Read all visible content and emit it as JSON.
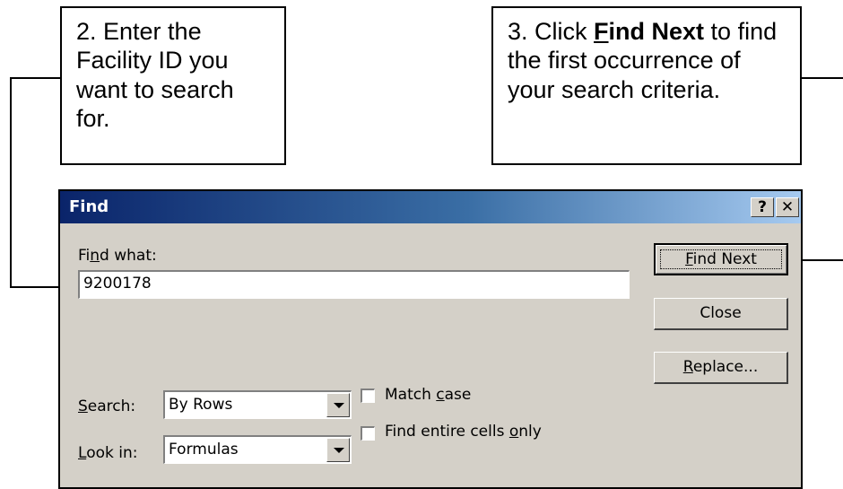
{
  "callout_2": {
    "text": "2. Enter the Facility ID you want to search for."
  },
  "callout_3": {
    "prefix": "3. Click ",
    "button_ref_first": "F",
    "button_ref_rest": "ind Next",
    "suffix": " to find the first occurrence of your search criteria."
  },
  "dialog": {
    "title": "Find",
    "help_glyph": "?",
    "close_glyph": "✕",
    "find_what_label": {
      "pre": "Fi",
      "acc": "n",
      "post": "d what:"
    },
    "find_what_value": "9200178",
    "buttons": {
      "find_next": {
        "acc": "F",
        "rest": "ind Next"
      },
      "close": "Close",
      "replace": {
        "acc": "R",
        "rest": "eplace..."
      }
    },
    "search_label": {
      "acc": "S",
      "rest": "earch:"
    },
    "search_value": "By Rows",
    "look_in_label": {
      "acc": "L",
      "rest": "ook in:"
    },
    "look_in_value": "Formulas",
    "match_case": {
      "pre": "Match ",
      "acc": "c",
      "post": "ase",
      "checked": false
    },
    "entire_cells": {
      "pre": "Find entire cells ",
      "acc": "o",
      "post": "nly",
      "checked": false
    }
  },
  "icons": [
    "arrow-right-icon",
    "arrow-left-icon",
    "dropdown-arrow-icon",
    "help-icon",
    "close-icon"
  ],
  "colors": {
    "title_bar_start": "#0a246a",
    "title_bar_end": "#a6caf0",
    "dialog_face": "#d4d0c8"
  }
}
